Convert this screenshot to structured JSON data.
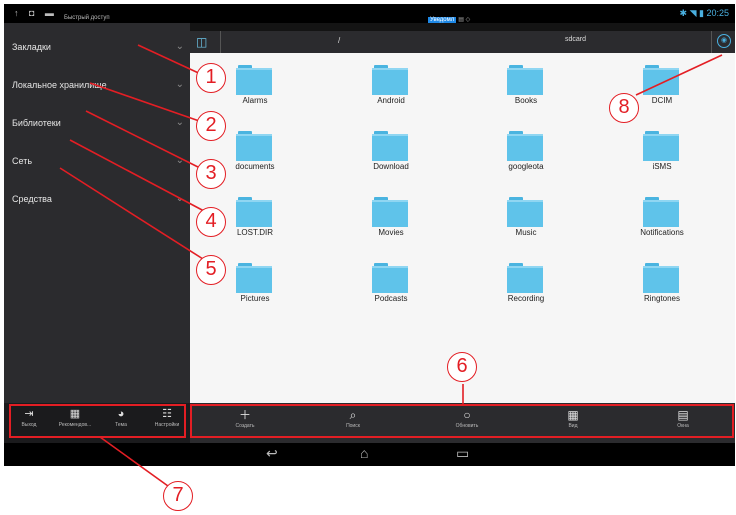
{
  "status_bar": {
    "left_icons": "↑ ◘ ▬",
    "quick_access": "Быстрый доступ",
    "center_badge": "Уведомл",
    "center_extra": "▤ ◇",
    "time": "20:25"
  },
  "sidebar": {
    "items": [
      {
        "label": "Закладки"
      },
      {
        "label": "Локальное хранилище"
      },
      {
        "label": "Библиотеки"
      },
      {
        "label": "Сеть"
      },
      {
        "label": "Средства"
      }
    ],
    "toolbar": [
      {
        "label": "Выход",
        "icon": "exit-icon"
      },
      {
        "label": "Рекомендов...",
        "icon": "gift-icon"
      },
      {
        "label": "Тема",
        "icon": "palette-icon"
      },
      {
        "label": "Настройки",
        "icon": "sliders-icon"
      }
    ]
  },
  "path_bar": {
    "root": "/",
    "current": "sdcard"
  },
  "folders": [
    {
      "name": "Alarms"
    },
    {
      "name": "Android"
    },
    {
      "name": "Books"
    },
    {
      "name": "DCIM"
    },
    {
      "name": "documents"
    },
    {
      "name": "Download"
    },
    {
      "name": "googleota"
    },
    {
      "name": "iSMS"
    },
    {
      "name": "LOST.DIR"
    },
    {
      "name": "Movies"
    },
    {
      "name": "Music"
    },
    {
      "name": "Notifications"
    },
    {
      "name": "Pictures"
    },
    {
      "name": "Podcasts"
    },
    {
      "name": "Recording"
    },
    {
      "name": "Ringtones"
    }
  ],
  "bottom_toolbar": [
    {
      "label": "Создать",
      "icon": "plus-icon"
    },
    {
      "label": "Поиск",
      "icon": "search-icon"
    },
    {
      "label": "Обновить",
      "icon": "refresh-icon"
    },
    {
      "label": "Вид",
      "icon": "grid-icon"
    },
    {
      "label": "Окна",
      "icon": "windows-icon"
    }
  ],
  "callouts": [
    "1",
    "2",
    "3",
    "4",
    "5",
    "6",
    "7",
    "8"
  ],
  "colors": {
    "accent": "#4ab0e0",
    "folder": "#5fc3ea",
    "annotation": "#e31e24",
    "sidebar_bg": "#2b2b2e"
  }
}
